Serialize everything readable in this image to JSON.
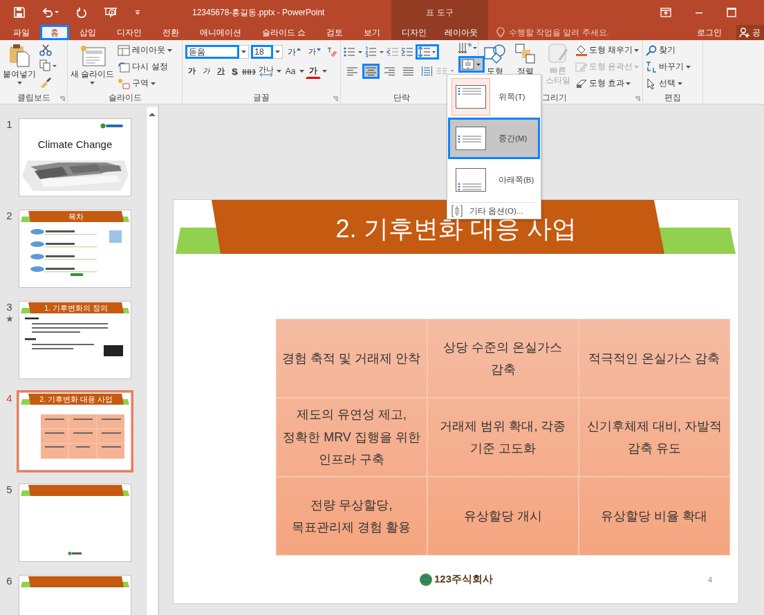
{
  "titlebar": {
    "title": "12345678-홍길동.pptx - PowerPoint",
    "context_label": "표 도구"
  },
  "tabs": [
    {
      "label": "파일",
      "selected": false,
      "highlighted": false,
      "contextual": false
    },
    {
      "label": "홈",
      "selected": true,
      "highlighted": true,
      "contextual": false
    },
    {
      "label": "삽입",
      "selected": false,
      "highlighted": false,
      "contextual": false
    },
    {
      "label": "디자인",
      "selected": false,
      "highlighted": false,
      "contextual": false
    },
    {
      "label": "전환",
      "selected": false,
      "highlighted": false,
      "contextual": false
    },
    {
      "label": "애니메이션",
      "selected": false,
      "highlighted": false,
      "contextual": false
    },
    {
      "label": "슬라이드 쇼",
      "selected": false,
      "highlighted": false,
      "contextual": false
    },
    {
      "label": "검토",
      "selected": false,
      "highlighted": false,
      "contextual": false
    },
    {
      "label": "보기",
      "selected": false,
      "highlighted": false,
      "contextual": false
    },
    {
      "label": "디자인",
      "selected": false,
      "highlighted": false,
      "contextual": true
    },
    {
      "label": "레이아웃",
      "selected": false,
      "highlighted": false,
      "contextual": true
    }
  ],
  "tell_me": {
    "placeholder": "수행할 작업을 알려 주세요."
  },
  "account": {
    "login": "로그인",
    "share": "공"
  },
  "ribbon": {
    "clipboard": {
      "label": "클립보드",
      "paste": "붙여넣기"
    },
    "slides": {
      "label": "슬라이드",
      "new_slide": "새 슬라이드",
      "layout": "레이아웃",
      "reset": "다시 설정",
      "section": "구역"
    },
    "font": {
      "label": "글꼴",
      "family": {
        "value": "돋움",
        "highlighted": true
      },
      "size": {
        "value": "18",
        "highlighted": true
      },
      "grow": "가",
      "shrink": "가",
      "bold": "가",
      "italic": "가",
      "underline": "가",
      "shadow": "S",
      "spacing": "가나",
      "case": "Aa",
      "font_color_label": "가"
    },
    "paragraph": {
      "label": "단락",
      "line_spacing": {
        "highlighted": true
      },
      "align": [
        {
          "kind": "left",
          "selected": false,
          "highlighted": false
        },
        {
          "kind": "center",
          "selected": true,
          "highlighted": true
        },
        {
          "kind": "right",
          "selected": false,
          "highlighted": false
        },
        {
          "kind": "justify",
          "selected": false,
          "highlighted": false
        },
        {
          "kind": "distributed",
          "selected": false,
          "highlighted": false
        }
      ],
      "align_text": {
        "highlighted": true,
        "pressed": true
      }
    },
    "drawing": {
      "label": "그리기",
      "shapes": "도형",
      "arrange": "정렬",
      "quick_styles": {
        "label": "빠른 스타일",
        "disabled": true
      },
      "commands": [
        {
          "kind": "fill",
          "label": "도형 채우기",
          "disabled": false
        },
        {
          "kind": "outline",
          "label": "도형 윤곽선",
          "disabled": true
        },
        {
          "kind": "effects",
          "label": "도형 효과",
          "disabled": false
        }
      ]
    },
    "editing": {
      "label": "편집",
      "commands": [
        {
          "kind": "find",
          "label": "찾기",
          "dropdown": false
        },
        {
          "kind": "replace",
          "label": "바꾸기",
          "dropdown": true
        },
        {
          "kind": "select",
          "label": "선택",
          "dropdown": true
        }
      ]
    }
  },
  "align_menu": {
    "items": [
      {
        "kind": "top",
        "label": "위쪽(T)",
        "checked": true,
        "selected": false,
        "highlighted": false
      },
      {
        "kind": "middle",
        "label": "중간(M)",
        "checked": false,
        "selected": true,
        "highlighted": true
      },
      {
        "kind": "bottom",
        "label": "아래쪽(B)",
        "checked": false,
        "selected": false,
        "highlighted": false
      }
    ],
    "more": "기타 옵션(O)..."
  },
  "slides": [
    {
      "number": "1",
      "kind": "title",
      "title": "Climate Change",
      "selected": false,
      "animated": false
    },
    {
      "number": "2",
      "kind": "contents",
      "title": "목차",
      "selected": false,
      "animated": false
    },
    {
      "number": "3",
      "kind": "text",
      "title": "1. 기후변화의 정의",
      "selected": false,
      "animated": true
    },
    {
      "number": "4",
      "kind": "table",
      "title": "2. 기후변화 대응 사업",
      "selected": true,
      "animated": false
    },
    {
      "number": "5",
      "kind": "blank",
      "selected": false,
      "animated": false,
      "logo": true
    },
    {
      "number": "6",
      "kind": "blank",
      "selected": false,
      "animated": false
    }
  ],
  "slide": {
    "title": "2. 기후변화 대응 사업",
    "table": {
      "rows": [
        [
          "경험 축적 및 거래제 안착",
          "상당 수준의 온실가스 감축",
          "적극적인 온실가스 감축"
        ],
        [
          "제도의 유연성 제고, 정확한 MRV 집행을 위한 인프라 구축",
          "거래제 범위 확대, 각종 기준 고도화",
          "신기후체제 대비, 자발적 감축 유도"
        ],
        [
          "전량 무상할당, 목표관리제 경험 활용",
          "유상할당 개시",
          "유상할당 비율 확대"
        ]
      ]
    },
    "logo": "123주식회사",
    "page": "4"
  }
}
